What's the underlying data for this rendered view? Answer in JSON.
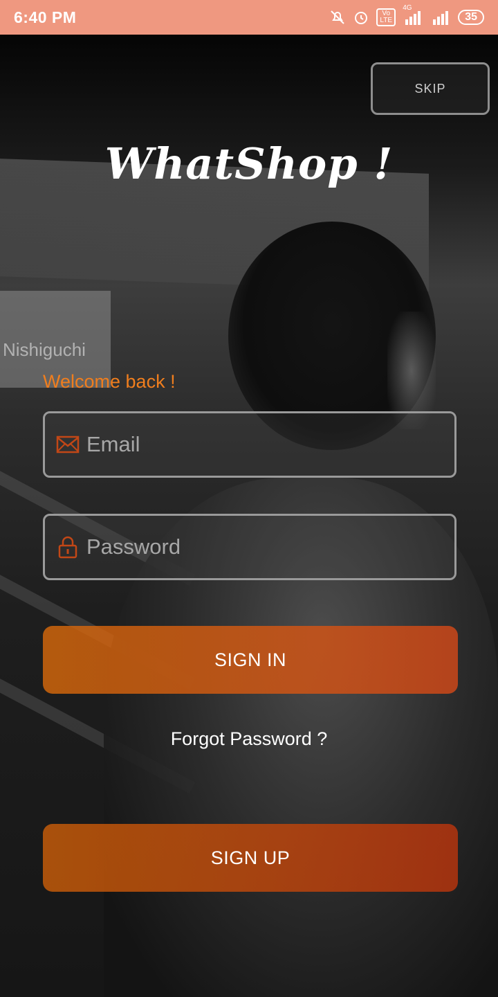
{
  "status_bar": {
    "time": "6:40 PM",
    "network_4g": "4G",
    "volte": "Vo LTE",
    "battery": "35"
  },
  "header": {
    "skip_label": "SKIP",
    "logo_text": "WhatShop !"
  },
  "background_photo": {
    "sign_text": "Nishiguchi"
  },
  "login": {
    "welcome": "Welcome back !",
    "email_placeholder": "Email",
    "password_placeholder": "Password",
    "sign_in_label": "SIGN IN",
    "forgot_label": "Forgot Password ?",
    "sign_up_label": "SIGN UP"
  },
  "icons": {
    "email": "envelope-icon",
    "password": "lock-icon"
  },
  "colors": {
    "status_bar": "#ef9880",
    "accent": "#f07e1e",
    "button_start": "#de6c0a",
    "button_end": "#d24818"
  }
}
